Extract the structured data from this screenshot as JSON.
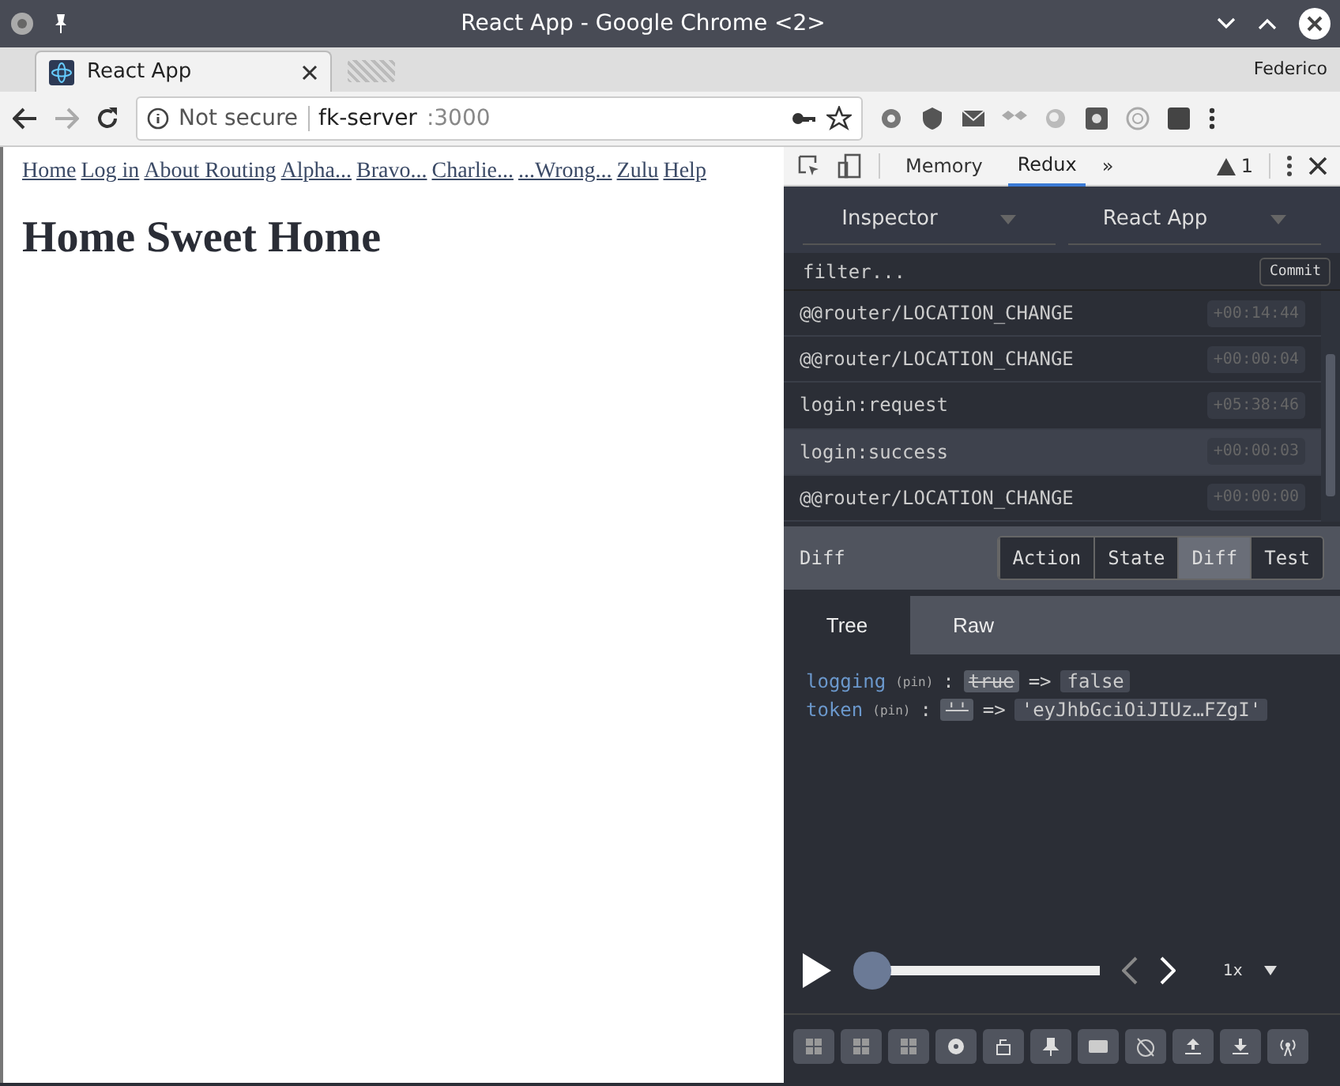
{
  "window": {
    "title": "React App - Google Chrome <2>"
  },
  "browser_tabs": [
    {
      "label": "React App",
      "selected": true
    }
  ],
  "profile": "Federico",
  "address_bar": {
    "security": "Not secure",
    "host": "fk-server",
    "port": ":3000"
  },
  "page": {
    "links": [
      "Home",
      "Log in",
      "About Routing",
      "Alpha...",
      "Bravo...",
      "Charlie...",
      "...Wrong...",
      "Zulu",
      "Help"
    ],
    "heading": "Home Sweet Home"
  },
  "devtools": {
    "tabs": [
      {
        "label": "Memory",
        "selected": false
      },
      {
        "label": "Redux",
        "selected": true
      }
    ],
    "more": "»",
    "warnings": "1"
  },
  "redux": {
    "selects": [
      "Inspector",
      "React App"
    ],
    "filter": {
      "placeholder": "filter..."
    },
    "commit": "Commit",
    "actions": [
      {
        "name": "@@router/LOCATION_CHANGE",
        "time": "+00:14:44",
        "selected": false
      },
      {
        "name": "@@router/LOCATION_CHANGE",
        "time": "+00:00:04",
        "selected": false
      },
      {
        "name": "login:request",
        "time": "+05:38:46",
        "selected": false
      },
      {
        "name": "login:success",
        "time": "+00:00:03",
        "selected": true
      },
      {
        "name": "@@router/LOCATION_CHANGE",
        "time": "+00:00:00",
        "selected": false
      }
    ],
    "panel_title": "Diff",
    "monitor_tabs": [
      {
        "label": "Action",
        "selected": false
      },
      {
        "label": "State",
        "selected": false
      },
      {
        "label": "Diff",
        "selected": true
      },
      {
        "label": "Test",
        "selected": false
      }
    ],
    "view_tabs": [
      {
        "label": "Tree",
        "selected": true
      },
      {
        "label": "Raw",
        "selected": false
      }
    ],
    "diff": [
      {
        "key": "logging",
        "pin": "(pin)",
        "separator": ":",
        "old": "true",
        "arrow": "=>",
        "new": "false"
      },
      {
        "key": "token",
        "pin": "(pin)",
        "separator": ":",
        "old": "''",
        "arrow": "=>",
        "new": "'eyJhbGciOiJIUz…FZgI'"
      }
    ],
    "player": {
      "level": 0,
      "speed": "1x"
    }
  }
}
